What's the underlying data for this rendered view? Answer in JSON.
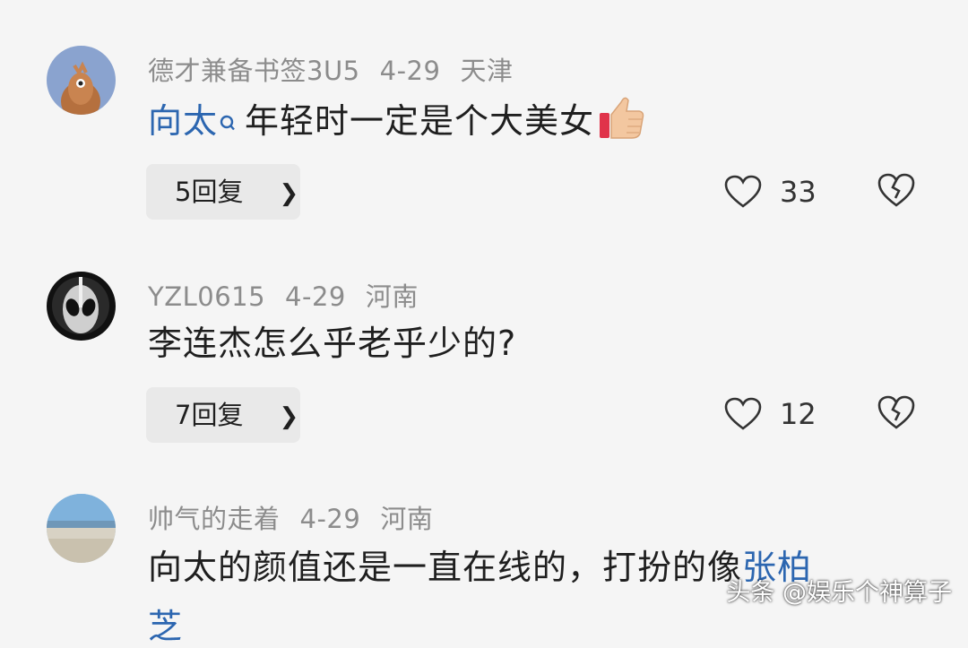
{
  "comments": [
    {
      "author": "德才兼备书签3U5",
      "date": "4-29",
      "location": "天津",
      "mention": "向太",
      "text": "年轻时一定是个大美女",
      "emoji": "thumbs-up",
      "replies_label": "5回复",
      "likes": "33"
    },
    {
      "author": "YZL0615",
      "date": "4-29",
      "location": "河南",
      "text": "李连杰怎么乎老乎少的?",
      "replies_label": "7回复",
      "likes": "12"
    },
    {
      "author": "帅气的走着",
      "date": "4-29",
      "location": "河南",
      "text": "向太的颜值还是一直在线的，打扮的像",
      "mention_tail": "张柏",
      "next_line_partial": "芝"
    }
  ],
  "watermark": "头条 @娱乐个神算子",
  "colors": {
    "background": "#f5f5f5",
    "mention": "#2c66b0",
    "meta": "#8c8c8c",
    "reply_bg": "#e9e9e9"
  },
  "icons": [
    "heart-icon",
    "broken-heart-icon",
    "chevron-right-icon",
    "search-icon",
    "thumbs-up-icon"
  ]
}
